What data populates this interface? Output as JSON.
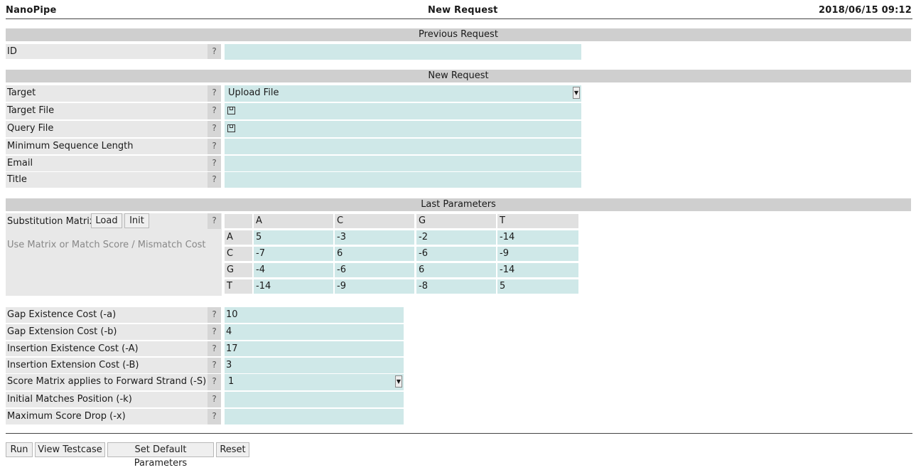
{
  "header": {
    "app_name": "NanoPipe",
    "page_title": "New Request",
    "timestamp": "2018/06/15 09:12"
  },
  "previous_request": {
    "section_title": "Previous Request",
    "id_label": "ID",
    "help": "?",
    "id_value": ""
  },
  "new_request": {
    "section_title": "New Request",
    "rows": [
      {
        "label": "Target",
        "value": "Upload File"
      },
      {
        "label": "Target File",
        "value": ""
      },
      {
        "label": "Query File",
        "value": ""
      },
      {
        "label": "Minimum Sequence Length",
        "value": ""
      },
      {
        "label": "Email",
        "value": ""
      },
      {
        "label": "Title",
        "value": ""
      }
    ]
  },
  "last_parameters": {
    "section_title": "Last Parameters",
    "matrix_label": "Substitution Matrix",
    "load_button": "Load",
    "init_button": "Init",
    "hint": "Use Matrix or Match Score / Mismatch Cost",
    "columns": [
      "A",
      "C",
      "G",
      "T"
    ],
    "rows": [
      {
        "name": "A",
        "values": [
          "5",
          "-3",
          "-2",
          "-14"
        ]
      },
      {
        "name": "C",
        "values": [
          "-7",
          "6",
          "-6",
          "-9"
        ]
      },
      {
        "name": "G",
        "values": [
          "-4",
          "-6",
          "6",
          "-14"
        ]
      },
      {
        "name": "T",
        "values": [
          "-14",
          "-9",
          "-8",
          "5"
        ]
      }
    ]
  },
  "params": [
    {
      "label": "Gap Existence Cost (-a)",
      "value": "10"
    },
    {
      "label": "Gap Extension Cost (-b)",
      "value": "4"
    },
    {
      "label": "Insertion Existence Cost (-A)",
      "value": "17"
    },
    {
      "label": "Insertion Extension Cost (-B)",
      "value": "3"
    },
    {
      "label": "Score Matrix applies to Forward Strand (-S)",
      "value": "1"
    },
    {
      "label": "Initial Matches Position (-k)",
      "value": ""
    },
    {
      "label": "Maximum Score Drop (-x)",
      "value": ""
    }
  ],
  "footer_buttons": {
    "run": "Run",
    "view_testcase": "View Testcase",
    "set_default": "Set Default Parameters",
    "reset": "Reset"
  },
  "colors": {
    "field_bg": "#cfe8e8",
    "label_bg": "#e8e8e8",
    "section_bg": "#cfcfcf"
  }
}
